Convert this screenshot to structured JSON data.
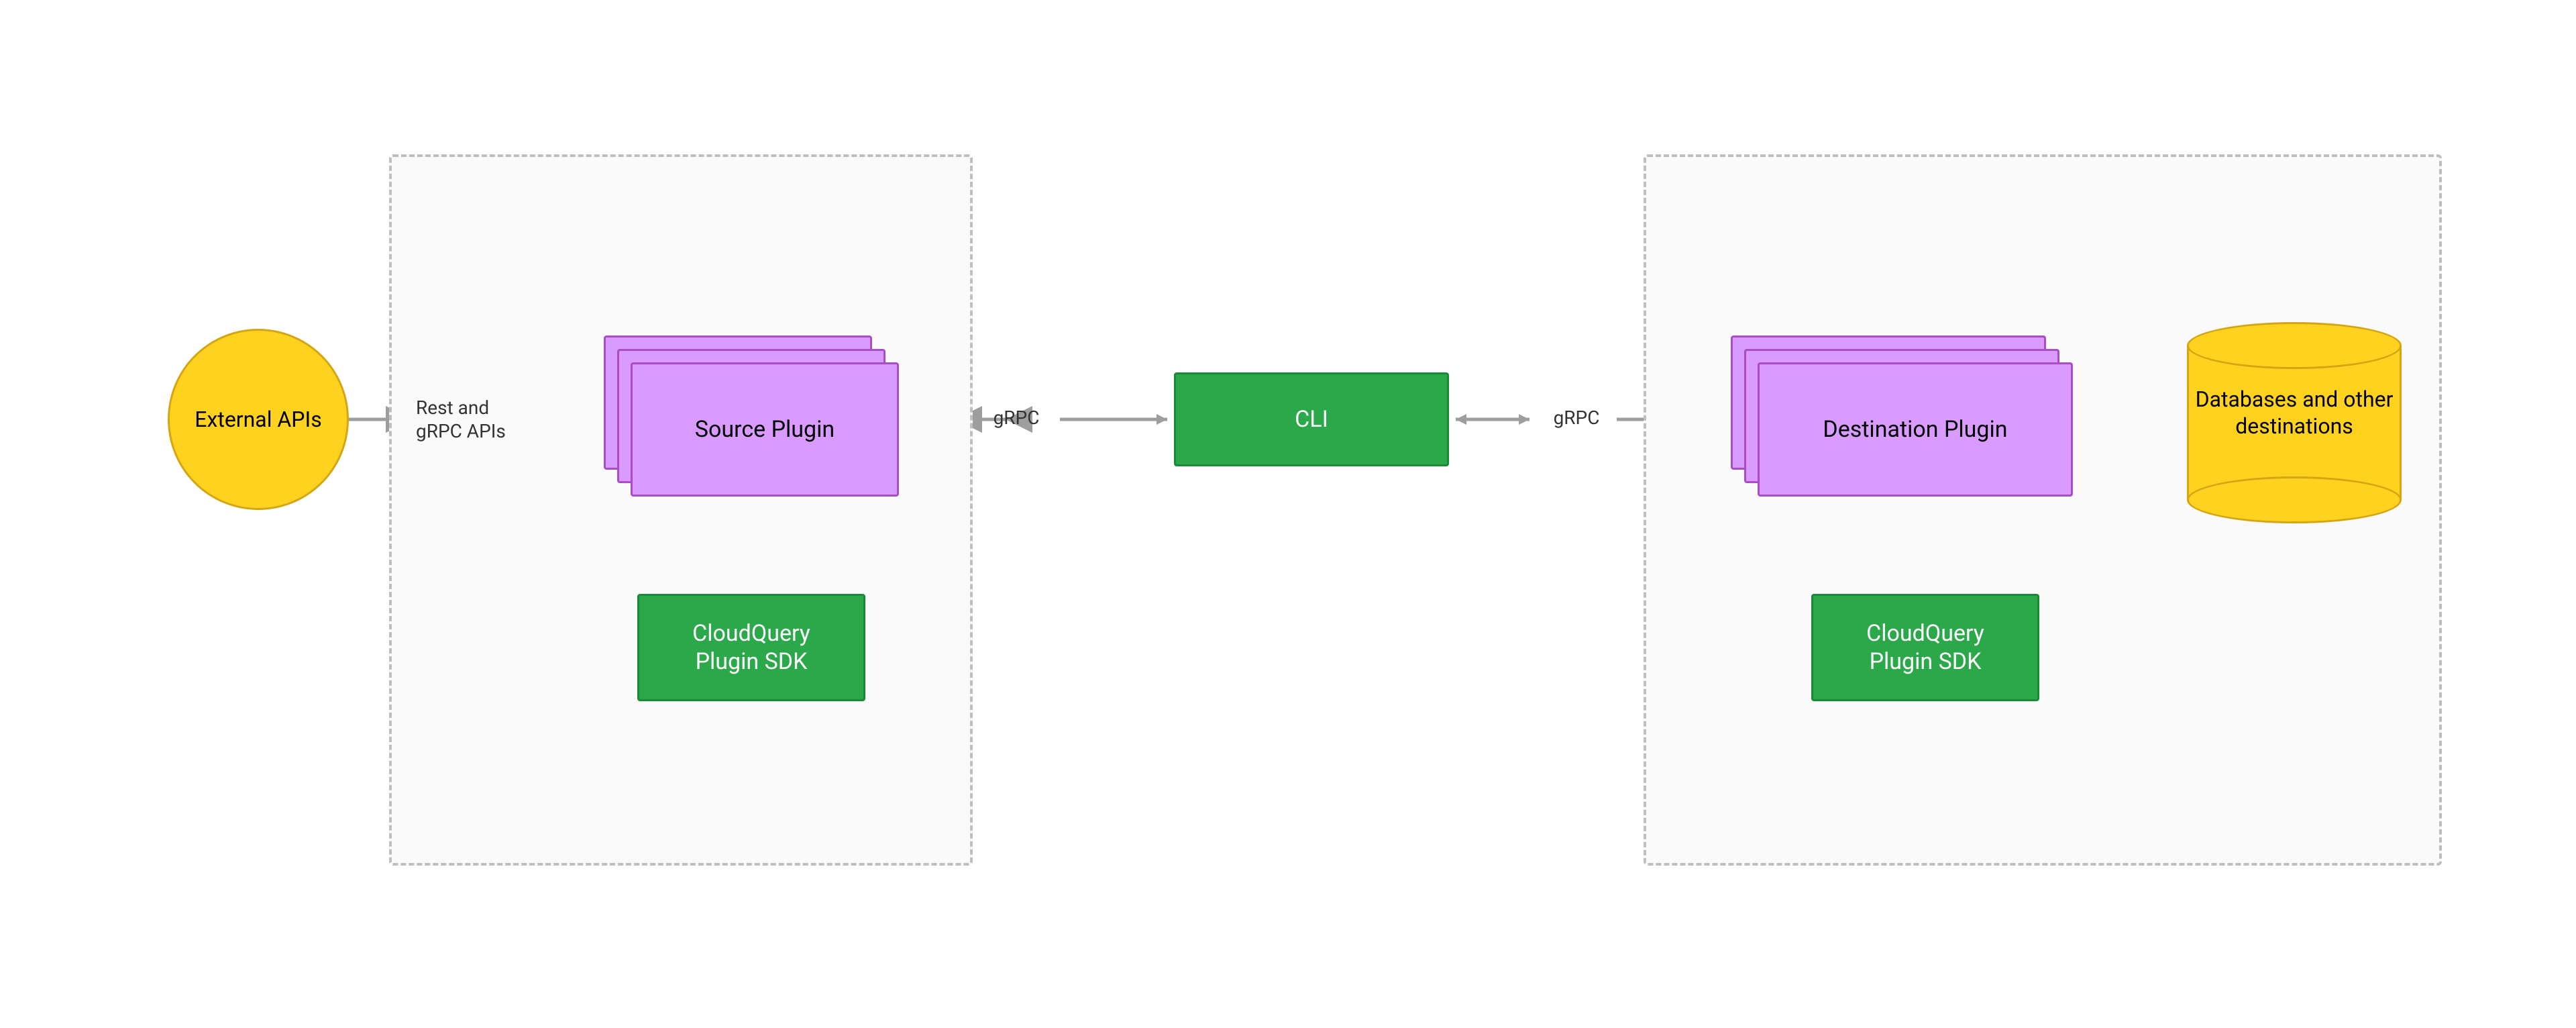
{
  "nodes": {
    "external_apis": "External APIs",
    "source_plugin": "Source Plugin",
    "source_sdk": "CloudQuery\nPlugin SDK",
    "cli": "CLI",
    "destination_plugin": "Destination Plugin",
    "destination_sdk": "CloudQuery\nPlugin SDK",
    "databases": "Databases and other destinations"
  },
  "labels": {
    "rest_grpc": "Rest and gRPC APIs",
    "grpc_left": "gRPC",
    "grpc_right": "gRPC"
  },
  "colors": {
    "yellow": "#ffd21f",
    "yellowBorder": "#d4a613",
    "green": "#2ba84a",
    "greenBorder": "#198a35",
    "purple": "#d99bff",
    "purpleBorder": "#a84dc4",
    "arrow": "#9e9e9e"
  }
}
